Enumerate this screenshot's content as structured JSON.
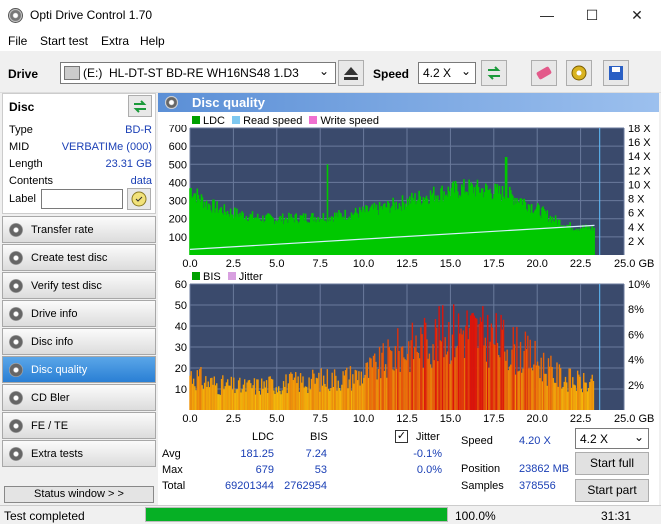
{
  "window": {
    "title": "Opti Drive Control 1.70",
    "minimize": "—",
    "maximize": "☐",
    "close": "✕"
  },
  "menu": [
    "File",
    "Start test",
    "Extra",
    "Help"
  ],
  "toolbar": {
    "drive_label": "Drive",
    "drive_letter": "(E:)",
    "drive_name": "HL-DT-ST BD-RE  WH16NS48 1.D3",
    "speed_label": "Speed",
    "speed_value": "4.2 X"
  },
  "disc": {
    "header": "Disc",
    "rows": [
      {
        "key": "Type",
        "value": "BD-R"
      },
      {
        "key": "MID",
        "value": "VERBATIMe (000)"
      },
      {
        "key": "Length",
        "value": "23.31 GB"
      },
      {
        "key": "Contents",
        "value": "data"
      }
    ],
    "label_key": "Label",
    "label_value": ""
  },
  "nav": [
    {
      "label": "Transfer rate",
      "active": false
    },
    {
      "label": "Create test disc",
      "active": false
    },
    {
      "label": "Verify test disc",
      "active": false
    },
    {
      "label": "Drive info",
      "active": false
    },
    {
      "label": "Disc info",
      "active": false
    },
    {
      "label": "Disc quality",
      "active": true
    },
    {
      "label": "CD Bler",
      "active": false
    },
    {
      "label": "FE / TE",
      "active": false
    },
    {
      "label": "Extra tests",
      "active": false
    }
  ],
  "status_window_label": "Status window > >",
  "panel_title": "Disc quality",
  "chart_data": [
    {
      "type": "area",
      "legend": [
        "LDC",
        "Read speed",
        "Write speed"
      ],
      "x_ticks": [
        "0.0",
        "2.5",
        "5.0",
        "7.5",
        "10.0",
        "12.5",
        "15.0",
        "17.5",
        "20.0",
        "22.5",
        "25.0 GB"
      ],
      "y_ticks_left": [
        "700",
        "600",
        "500",
        "400",
        "300",
        "200",
        "100"
      ],
      "y_ticks_right": [
        "18 X",
        "16 X",
        "14 X",
        "12 X",
        "10 X",
        "8 X",
        "6 X",
        "4 X",
        "2 X"
      ],
      "xlim": [
        0,
        25
      ],
      "ylim": [
        0,
        700
      ],
      "series": [
        {
          "name": "LDC",
          "x": [
            0,
            0.5,
            1,
            2,
            3,
            4,
            5,
            6,
            7,
            8,
            9,
            10,
            11,
            12,
            13,
            14,
            15,
            16,
            17,
            18,
            19,
            20,
            21,
            22,
            23.3
          ],
          "values": [
            380,
            330,
            290,
            250,
            230,
            210,
            205,
            210,
            215,
            220,
            230,
            245,
            265,
            290,
            320,
            345,
            365,
            380,
            370,
            350,
            320,
            260,
            200,
            160,
            150
          ]
        },
        {
          "name": "Read speed",
          "x": [
            0,
            23.3
          ],
          "values": [
            0.8,
            4.2
          ]
        }
      ],
      "spikes": [
        {
          "x": 7.9,
          "value": 500
        },
        {
          "x": 18.2,
          "value": 540
        }
      ]
    },
    {
      "type": "bar",
      "legend": [
        "BIS",
        "Jitter"
      ],
      "x_ticks": [
        "0.0",
        "2.5",
        "5.0",
        "7.5",
        "10.0",
        "12.5",
        "15.0",
        "17.5",
        "20.0",
        "22.5",
        "25.0 GB"
      ],
      "y_ticks_left": [
        "60",
        "50",
        "40",
        "30",
        "20",
        "10"
      ],
      "y_ticks_right": [
        "10%",
        "8%",
        "6%",
        "4%",
        "2%"
      ],
      "xlim": [
        0,
        25
      ],
      "ylim": [
        0,
        60
      ],
      "series": [
        {
          "name": "BIS",
          "x": [
            0,
            1,
            2,
            3,
            4,
            5,
            6,
            7,
            8,
            9,
            10,
            11,
            12,
            13,
            14,
            15,
            16,
            17,
            18,
            19,
            20,
            21,
            22,
            23.3
          ],
          "values": [
            22,
            17,
            15,
            14,
            15,
            16,
            17,
            18,
            19,
            20,
            22,
            28,
            36,
            40,
            44,
            48,
            50,
            45,
            42,
            36,
            30,
            22,
            18,
            15
          ]
        }
      ]
    }
  ],
  "stats": {
    "col_ldc": "LDC",
    "col_bis": "BIS",
    "rows": [
      {
        "label": "Avg",
        "ldc": "181.25",
        "bis": "7.24",
        "jitter": "-0.1%"
      },
      {
        "label": "Max",
        "ldc": "679",
        "bis": "53",
        "jitter": "0.0%"
      },
      {
        "label": "Total",
        "ldc": "69201344",
        "bis": "2762954",
        "jitter": ""
      }
    ],
    "jitter_label": "Jitter",
    "jitter_checked": true,
    "speed_label": "Speed",
    "speed_value": "4.20 X",
    "position_label": "Position",
    "position_value": "23862 MB",
    "samples_label": "Samples",
    "samples_value": "378556",
    "speed_select": "4.2 X",
    "start_full": "Start full",
    "start_part": "Start part"
  },
  "status": {
    "text": "Test completed",
    "progress": 100.0,
    "progress_label": "100.0%",
    "time": "31:31"
  },
  "colors": {
    "ldc": "#00c800",
    "bis": "#e81010",
    "plot_bg": "#3a4a6c",
    "accent": "#2a7fd4"
  }
}
